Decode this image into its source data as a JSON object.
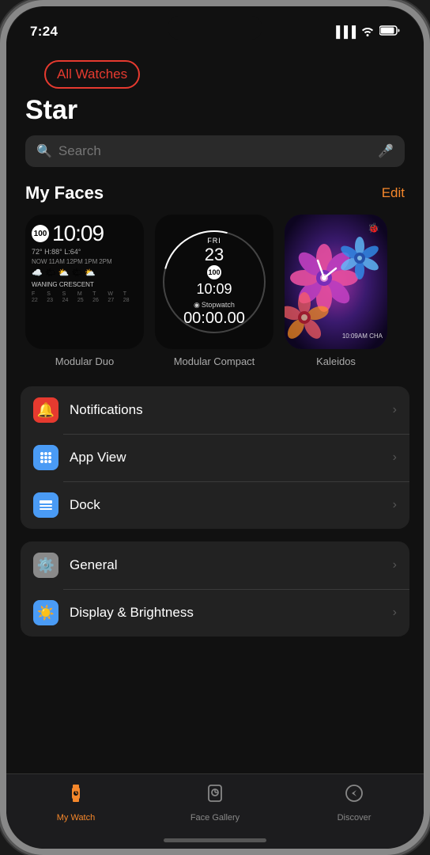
{
  "statusBar": {
    "time": "7:24",
    "locationIcon": "▶",
    "signal": "▐▐▐▐",
    "wifi": "wifi",
    "battery": "battery"
  },
  "navigation": {
    "allWatches": "All Watches"
  },
  "page": {
    "title": "Star"
  },
  "search": {
    "placeholder": "Search"
  },
  "myFaces": {
    "sectionTitle": "My Faces",
    "editLabel": "Edit",
    "faces": [
      {
        "id": "modular-duo",
        "label": "Modular Duo"
      },
      {
        "id": "modular-compact",
        "label": "Modular Compact"
      },
      {
        "id": "kaleidoscope",
        "label": "Kaleidos"
      }
    ]
  },
  "modularDuo": {
    "badge": "100",
    "time": "10:09",
    "weatherLine1": "72° H:88° L:64°",
    "weatherIcons": "☁️ 🌤 ⛅ 🌤",
    "moon": "WANING CRESCENT",
    "calDays": [
      "F",
      "S",
      "S",
      "M",
      "T",
      "W",
      "T"
    ]
  },
  "modularCompact": {
    "dayLabel": "FRI",
    "dateNum": "23",
    "badge": "100",
    "time": "10:09",
    "stopLabel": "Stopwatch",
    "stopIcon": "◉",
    "stopTime": "00:00.00"
  },
  "kaleidoscope": {
    "bugIcon": "🐞",
    "timeLabel": "10:09AM CHA"
  },
  "settings": {
    "section1": [
      {
        "id": "notifications",
        "icon": "🔔",
        "iconBg": "#e63a2f",
        "label": "Notifications"
      },
      {
        "id": "appview",
        "icon": "⬡",
        "iconBg": "#4a9bf5",
        "label": "App View"
      },
      {
        "id": "dock",
        "icon": "⬛",
        "iconBg": "#4a9bf5",
        "label": "Dock"
      }
    ],
    "section2": [
      {
        "id": "general",
        "icon": "⚙️",
        "iconBg": "#8a8a8a",
        "label": "General"
      },
      {
        "id": "display",
        "icon": "☀️",
        "iconBg": "#4a9bf5",
        "label": "Display & Brightness"
      }
    ]
  },
  "tabBar": {
    "tabs": [
      {
        "id": "my-watch",
        "icon": "⌚",
        "label": "My Watch",
        "active": true
      },
      {
        "id": "face-gallery",
        "icon": "🕐",
        "label": "Face Gallery",
        "active": false
      },
      {
        "id": "discover",
        "icon": "🧭",
        "label": "Discover",
        "active": false
      }
    ]
  }
}
